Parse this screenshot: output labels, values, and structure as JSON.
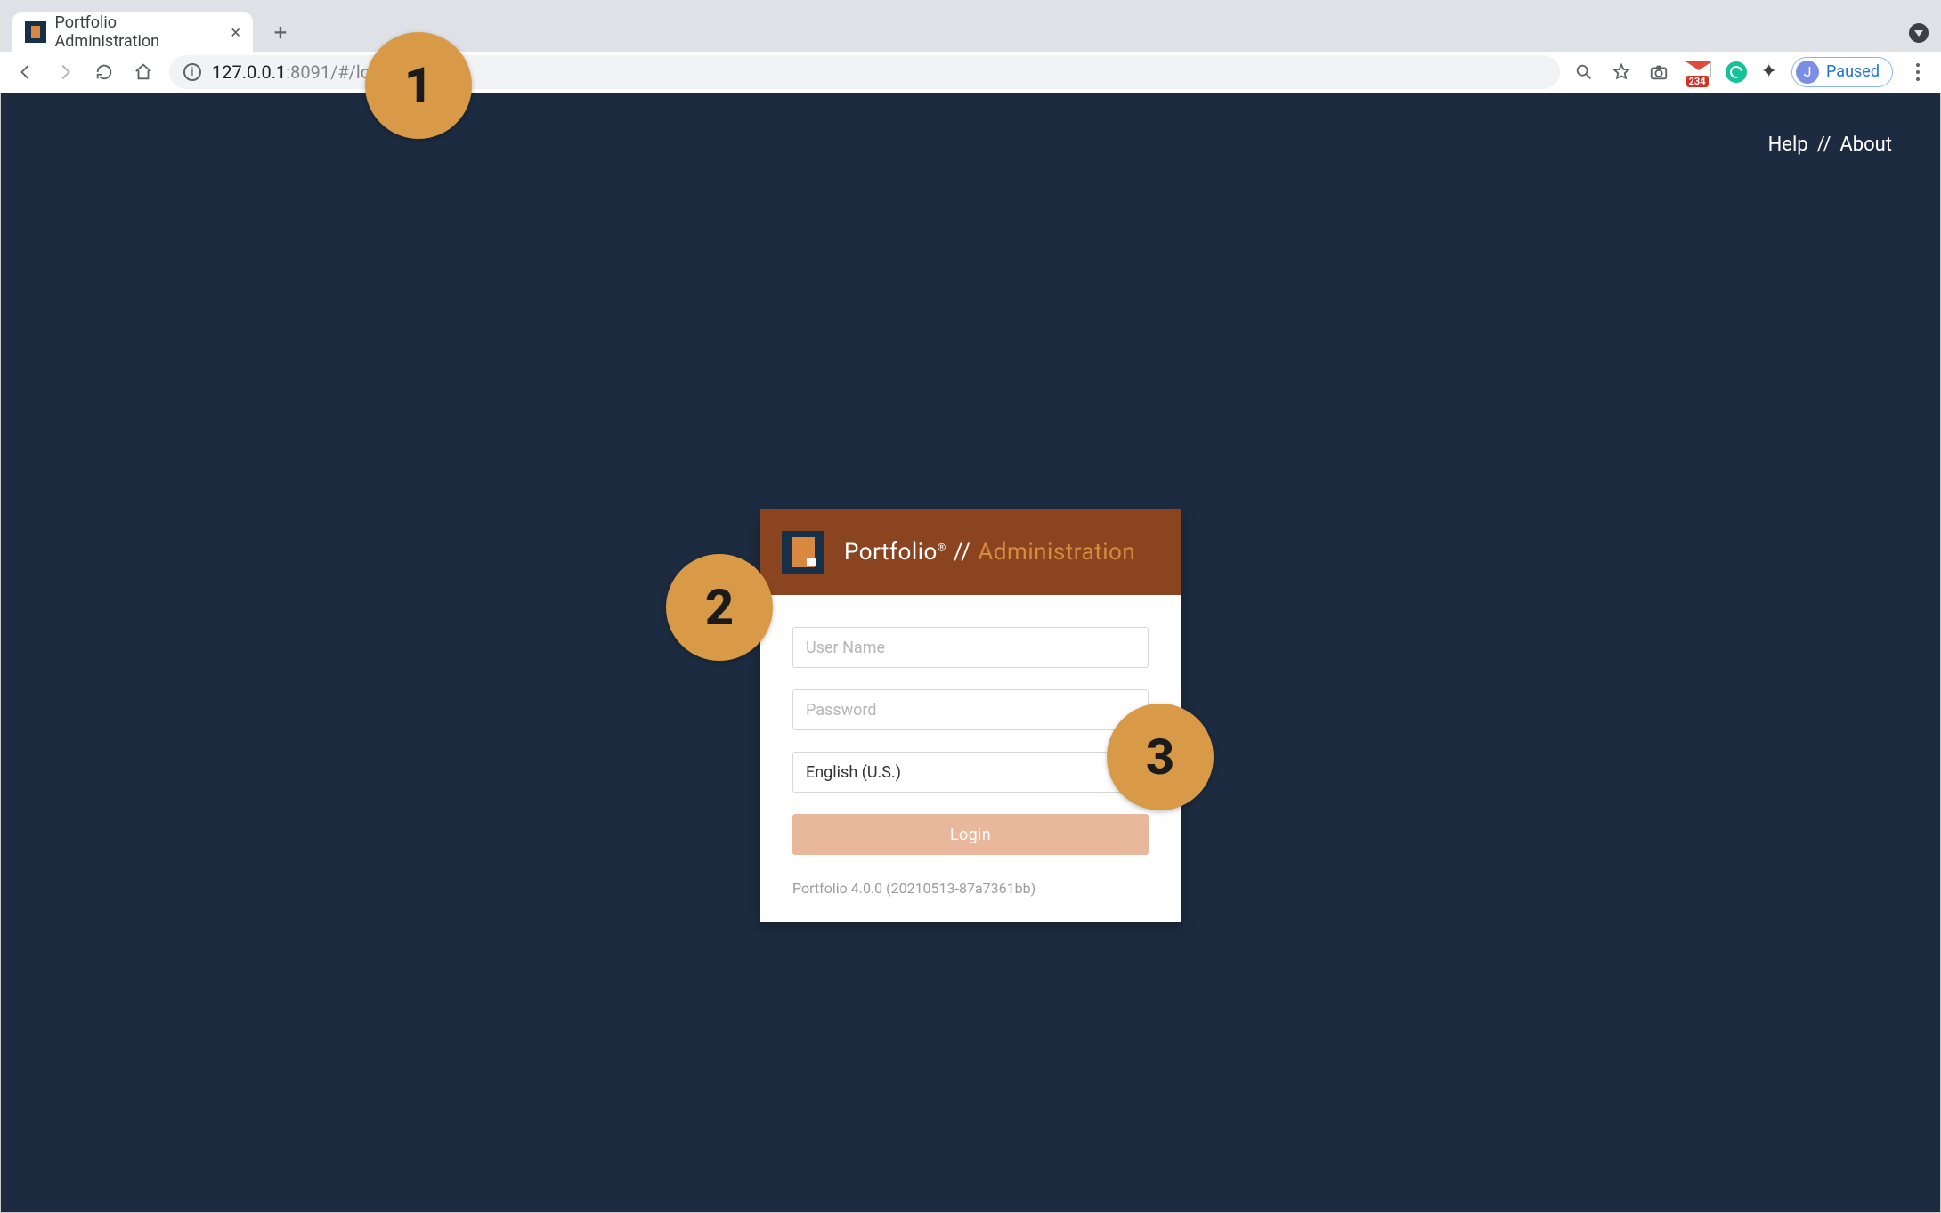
{
  "browser": {
    "tab_title": "Portfolio Administration",
    "url_host": "127.0.0.1",
    "url_rest": ":8091/#/login",
    "gmail_badge_count": "234",
    "profile_initial": "J",
    "profile_state": "Paused"
  },
  "top_links": {
    "help": "Help",
    "sep": "//",
    "about": "About"
  },
  "brand": {
    "name": "Portfolio",
    "reg": "®",
    "sep": "//",
    "suffix": "Administration"
  },
  "login": {
    "username_placeholder": "User Name",
    "password_placeholder": "Password",
    "language_selected": "English (U.S.)",
    "login_button": "Login",
    "version": "Portfolio 4.0.0 (20210513-87a7361bb)"
  },
  "annotations": {
    "a1": "1",
    "a2": "2",
    "a3": "3"
  }
}
